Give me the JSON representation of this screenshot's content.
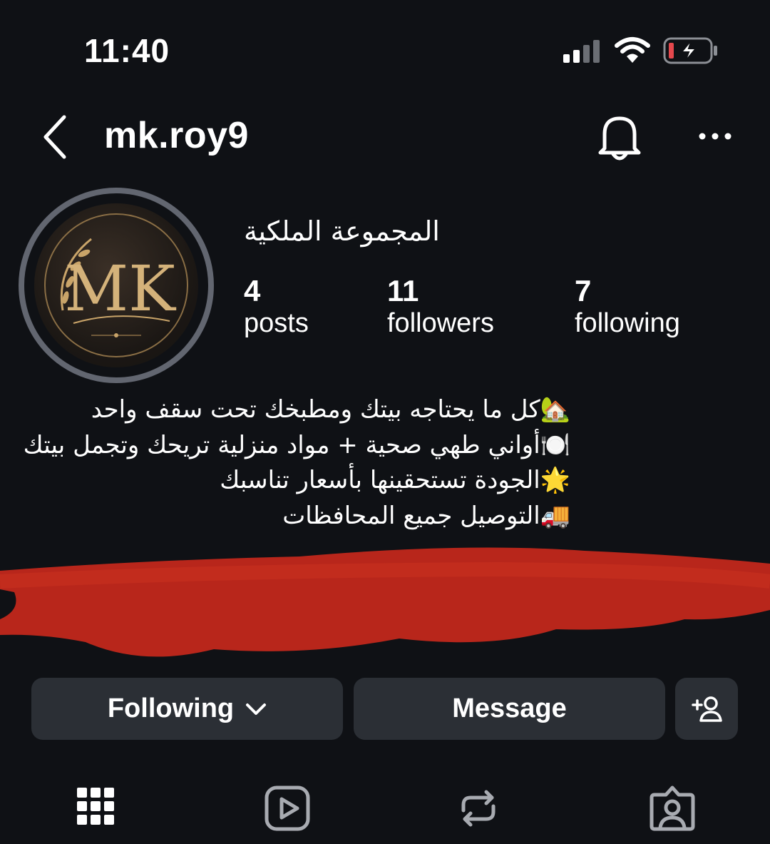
{
  "status_bar": {
    "time": "11:40",
    "icons": [
      "cellular-signal-icon",
      "wifi-icon",
      "battery-charging-icon"
    ]
  },
  "header": {
    "username": "mk.roy9",
    "icons": [
      "back-arrow-icon",
      "bell-icon",
      "more-options-icon"
    ]
  },
  "profile": {
    "display_name": "المجموعة الملكية",
    "avatar_monogram": "MK",
    "stats": [
      {
        "value": "4",
        "label": "posts"
      },
      {
        "value": "11",
        "label": "followers"
      },
      {
        "value": "7",
        "label": "following"
      }
    ],
    "bio": [
      "🏡كل ما يحتاجه بيتك ومطبخك تحت سقف واحد",
      "🍽️أواني طهي صحية + مواد منزلية تريحك وتجمل بيتك",
      "🌟الجودة تستحقينها بأسعار تناسبك",
      "🚚التوصيل جميع المحافظات"
    ]
  },
  "actions": {
    "following_label": "Following",
    "message_label": "Message"
  },
  "tabs": [
    "grid-icon",
    "reels-icon",
    "reposts-icon",
    "tagged-icon"
  ],
  "colors": {
    "background": "#0f1115",
    "button": "#2b2f35",
    "redaction": "#b8261b",
    "battery_low": "#e5484d",
    "avatar_gold": "#c9a469"
  }
}
